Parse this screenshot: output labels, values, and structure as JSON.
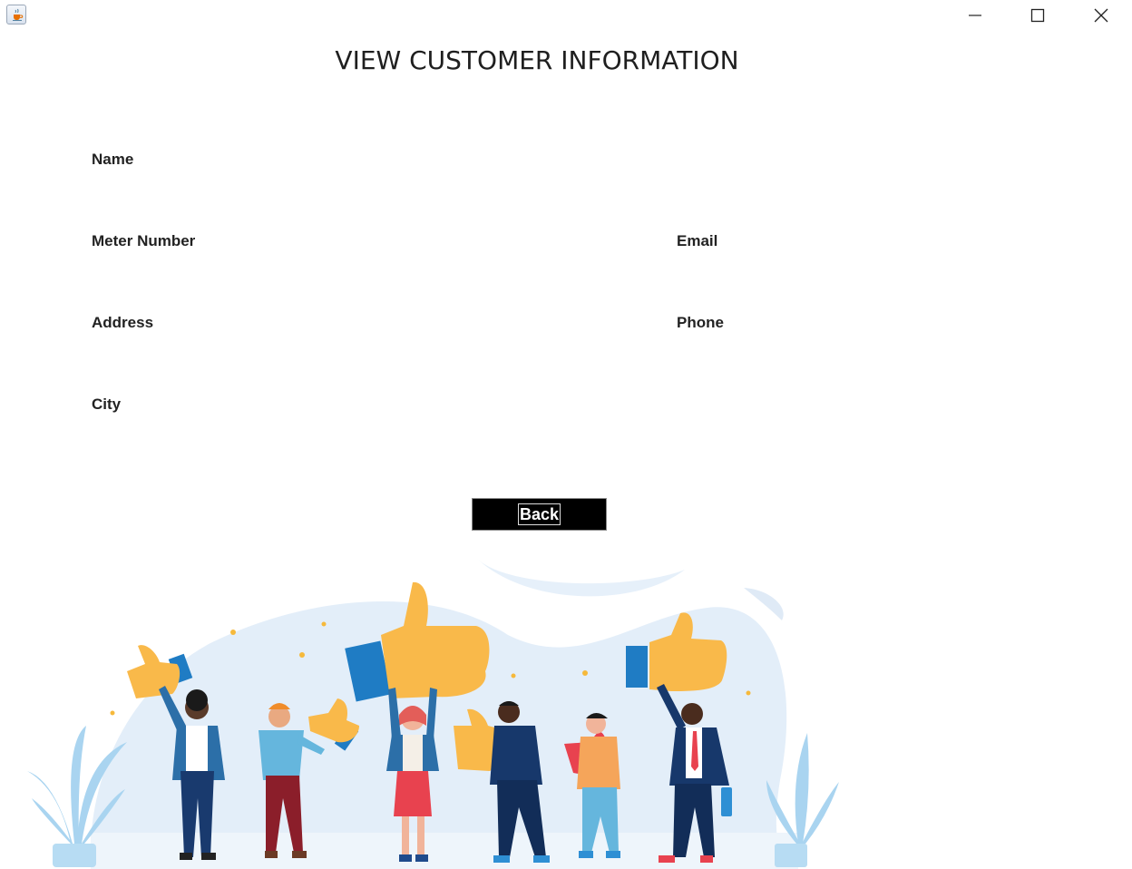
{
  "window": {
    "app_icon": "java-cup-icon",
    "controls": [
      "minimize-icon",
      "maximize-icon",
      "close-icon"
    ]
  },
  "page": {
    "title": "VIEW CUSTOMER INFORMATION"
  },
  "fields": {
    "name_label": "Name",
    "meter_number_label": "Meter Number",
    "email_label": "Email",
    "address_label": "Address",
    "phone_label": "Phone",
    "city_label": "City"
  },
  "actions": {
    "back_label": "Back"
  },
  "colors": {
    "background": "#ffffff",
    "button_bg": "#000000",
    "button_text": "#ffffff",
    "thumb_yellow": "#f9b94a",
    "cuff_blue": "#1f7cc4",
    "blob_blue": "#dcebf8"
  }
}
